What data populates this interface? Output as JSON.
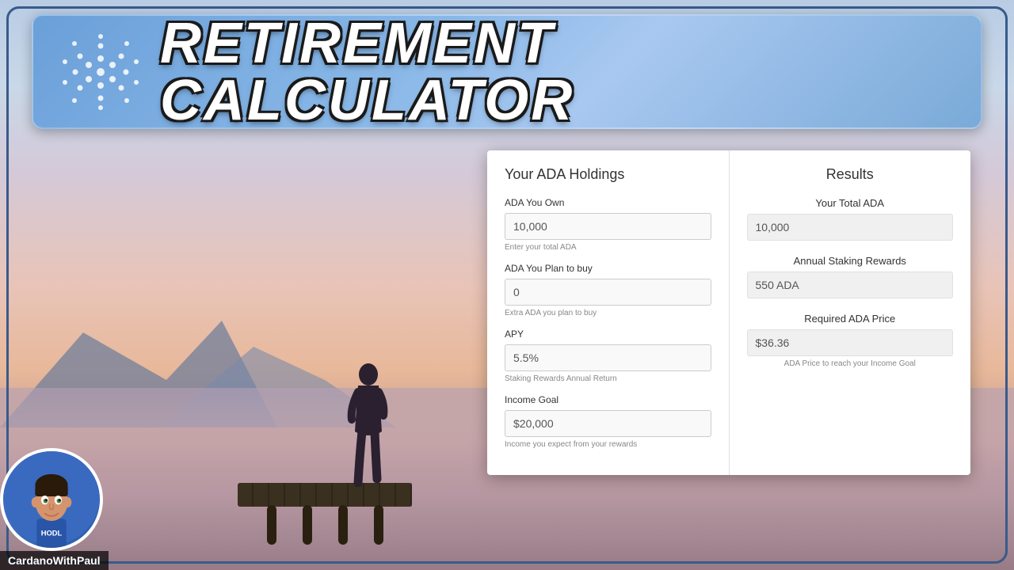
{
  "header": {
    "title": "RETIREMENT CALCULATOR",
    "logo_alt": "Cardano Logo"
  },
  "calculator": {
    "left_section_title": "Your ADA Holdings",
    "right_section_title": "Results",
    "fields": {
      "ada_owned": {
        "label": "ADA You Own",
        "value": "10,000",
        "hint": "Enter your total ADA"
      },
      "ada_to_buy": {
        "label": "ADA You Plan to buy",
        "value": "0",
        "hint": "Extra ADA you plan to buy"
      },
      "apy": {
        "label": "APY",
        "value": "5.5%",
        "hint": "Staking Rewards Annual Return"
      },
      "income_goal": {
        "label": "Income Goal",
        "value": "$20,000",
        "hint": "Income you expect from your rewards"
      }
    },
    "results": {
      "total_ada": {
        "label": "Your Total ADA",
        "value": "10,000"
      },
      "staking_rewards": {
        "label": "Annual Staking Rewards",
        "value": "550 ADA"
      },
      "required_price": {
        "label": "Required ADA Price",
        "value": "$36.36",
        "hint": "ADA Price to reach your Income Goal"
      }
    }
  },
  "brand": {
    "name": "CardanoWithPaul",
    "hodl_text": "HODL"
  }
}
